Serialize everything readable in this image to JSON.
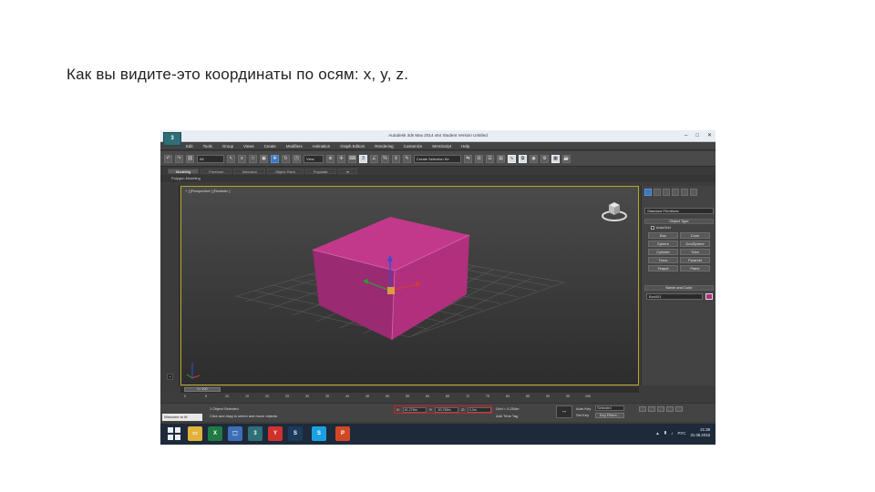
{
  "slide": {
    "caption": "Как вы видите-это координаты по осям: x, y, z."
  },
  "window": {
    "app_logo": "3",
    "title": "Autodesk 3ds Max 2014 x64    Student Version    Untitled",
    "controls": [
      "–",
      "□",
      "✕"
    ]
  },
  "menu": [
    "Edit",
    "Tools",
    "Group",
    "Views",
    "Create",
    "Modifiers",
    "Animation",
    "Graph Editors",
    "Rendering",
    "Customize",
    "MAXScript",
    "Help"
  ],
  "toolbar": {
    "filter_select": "All",
    "view_select": "View",
    "named_selection": "Create Selection Se"
  },
  "ribbon": {
    "tabs": [
      "Modeling",
      "Freeform",
      "Selection",
      "Object Paint",
      "Populate"
    ],
    "active_tab": "Modeling",
    "subtitle": "Polygon Modeling"
  },
  "viewport": {
    "label": "+ ] [Perspective ] [Realistic ]",
    "box_color": "#b0307d",
    "gizmo_colors": {
      "x": "#d23b2f",
      "y": "#2d9b35",
      "z": "#2f4fd6"
    }
  },
  "left_strip": {
    "add_btn": "+"
  },
  "command_panel": {
    "dropdown": "Standard Primitives",
    "object_type": "Object Type",
    "autogrid": "AutoGrid",
    "buttons": [
      "Box",
      "Cone",
      "Sphere",
      "GeoSphere",
      "Cylinder",
      "Tube",
      "Torus",
      "Pyramid",
      "Teapot",
      "Plane"
    ],
    "name_color": "Name and Color",
    "name_value": "Box001",
    "swatch_color": "#b0307d"
  },
  "timeline": {
    "slider": "0 / 100",
    "ticks": [
      "0",
      "5",
      "10",
      "15",
      "20",
      "25",
      "30",
      "35",
      "40",
      "45",
      "50",
      "55",
      "60",
      "65",
      "70",
      "75",
      "80",
      "85",
      "90",
      "95",
      "100"
    ]
  },
  "status": {
    "maxscript": "Welcome to M",
    "line1": "1 Object Selected",
    "line2": "Click and drag to select and move objects",
    "x_label": "X:",
    "x_value": "61,278m",
    "y_label": "Y:",
    "y_value": "-50,789m",
    "z_label": "Z:",
    "z_value": "0,0m",
    "grid": "Grid = 0,254m",
    "add_time_tag": "Add Time Tag",
    "auto_key": "Auto Key",
    "selected": "Selected",
    "set_key": "Set Key",
    "key_filters": "Key Filters..."
  },
  "taskbar": {
    "apps": [
      {
        "name": "explorer",
        "label": "▭",
        "color": "#e2b23a"
      },
      {
        "name": "excel",
        "label": "X",
        "color": "#1f7a43"
      },
      {
        "name": "photos",
        "label": "⬚",
        "color": "#3d6fb6"
      },
      {
        "name": "3dsmax",
        "label": "3",
        "color": "#2f6f78"
      },
      {
        "name": "yandex",
        "label": "Y",
        "color": "#d0312d"
      },
      {
        "name": "steam",
        "label": "S",
        "color": "#1b3a5c"
      },
      {
        "name": "skype",
        "label": "S",
        "color": "#1ba1e2"
      },
      {
        "name": "powerpoint",
        "label": "P",
        "color": "#d24726"
      }
    ],
    "language": "РУС",
    "time": "21:38",
    "date": "31.08.2015"
  }
}
